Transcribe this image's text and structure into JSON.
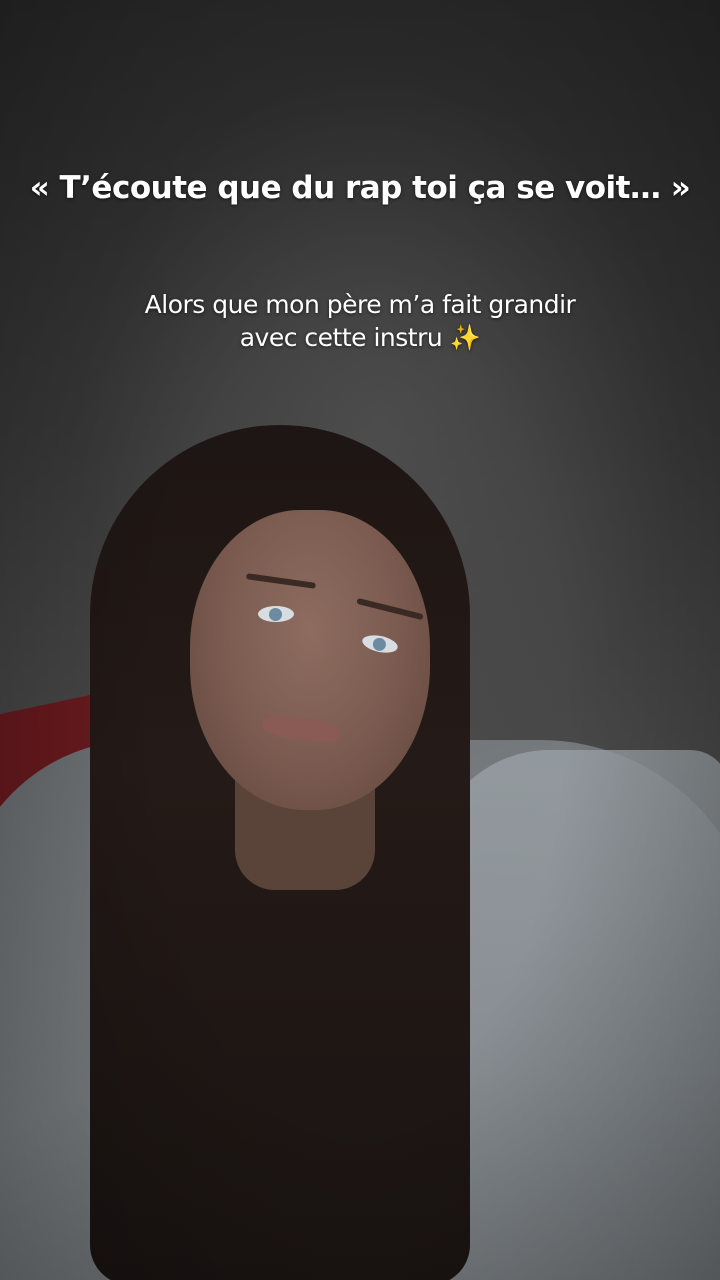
{
  "overlay": {
    "title": "« T’écoute que du rap toi ça se voit… »",
    "subtitle_line1": "Alors que mon père m’a fait grandir",
    "subtitle_line2": "avec cette instru ✨"
  }
}
